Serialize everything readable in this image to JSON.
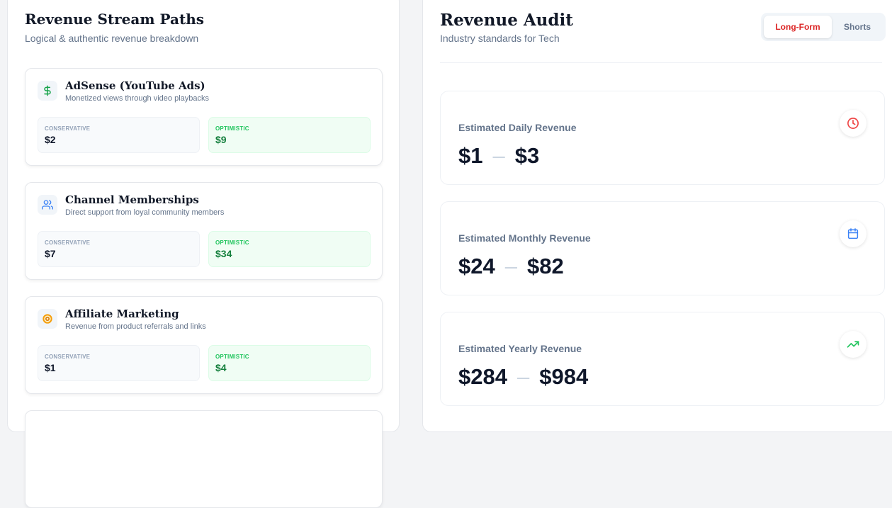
{
  "left": {
    "title": "Revenue Stream Paths",
    "subtitle": "Logical & authentic revenue breakdown",
    "streams": [
      {
        "icon": "dollar-icon",
        "name": "AdSense (YouTube Ads)",
        "desc": "Monetized views through video playbacks",
        "cons_label": "CONSERVATIVE",
        "cons": "$2",
        "opt_label": "OPTIMISTIC",
        "opt": "$9"
      },
      {
        "icon": "users-icon",
        "name": "Channel Memberships",
        "desc": "Direct support from loyal community members",
        "cons_label": "CONSERVATIVE",
        "cons": "$7",
        "opt_label": "OPTIMISTIC",
        "opt": "$34"
      },
      {
        "icon": "target-icon",
        "name": "Affiliate Marketing",
        "desc": "Revenue from product referrals and links",
        "cons_label": "CONSERVATIVE",
        "cons": "$1",
        "opt_label": "OPTIMISTIC",
        "opt": "$4"
      }
    ]
  },
  "right": {
    "title": "Revenue Audit",
    "subtitle": "Industry standards for Tech",
    "toggle": {
      "active": "Long-Form",
      "inactive": "Shorts"
    },
    "estimates": [
      {
        "label": "Estimated Daily Revenue",
        "low": "$1",
        "high": "$3",
        "icon": "clock-icon",
        "color": "#ef4444"
      },
      {
        "label": "Estimated Monthly Revenue",
        "low": "$24",
        "high": "$82",
        "icon": "calendar-icon",
        "color": "#3b82f6"
      },
      {
        "label": "Estimated Yearly Revenue",
        "low": "$284",
        "high": "$984",
        "icon": "trending-up-icon",
        "color": "#22c55e"
      }
    ]
  }
}
